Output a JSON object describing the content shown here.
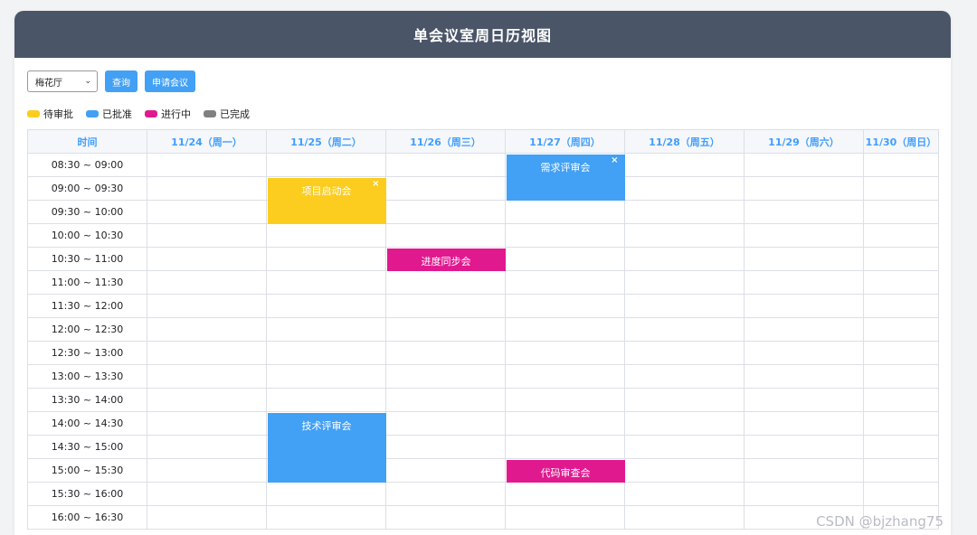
{
  "header": {
    "title": "单会议室周日历视图"
  },
  "toolbar": {
    "room_select": "梅花厅",
    "query_label": "查询",
    "apply_label": "申请会议"
  },
  "legend": [
    {
      "label": "待审批",
      "color": "#fccd1e"
    },
    {
      "label": "已批准",
      "color": "#42a0f5"
    },
    {
      "label": "进行中",
      "color": "#e0198f"
    },
    {
      "label": "已完成",
      "color": "#808080"
    }
  ],
  "table": {
    "time_header": "时间",
    "days": [
      "11/24（周一）",
      "11/25（周二）",
      "11/26（周三）",
      "11/27（周四）",
      "11/28（周五）",
      "11/29（周六）",
      "11/30（周日）"
    ],
    "slots": [
      "08:30 ~ 09:00",
      "09:00 ~ 09:30",
      "09:30 ~ 10:00",
      "10:00 ~ 10:30",
      "10:30 ~ 11:00",
      "11:00 ~ 11:30",
      "11:30 ~ 12:00",
      "12:00 ~ 12:30",
      "12:30 ~ 13:00",
      "13:00 ~ 13:30",
      "13:30 ~ 14:00",
      "14:00 ~ 14:30",
      "14:30 ~ 15:00",
      "15:00 ~ 15:30",
      "15:30 ~ 16:00",
      "16:00 ~ 16:30"
    ]
  },
  "events": [
    {
      "title": "项目启动会",
      "day": 1,
      "start": 1,
      "span": 2,
      "status": "pending",
      "color": "#fccd1e",
      "close": "×"
    },
    {
      "title": "需求评审会",
      "day": 3,
      "start": 0,
      "span": 2,
      "status": "approved",
      "color": "#42a0f5",
      "close": "×"
    },
    {
      "title": "进度同步会",
      "day": 2,
      "start": 4,
      "span": 1,
      "status": "in-progress",
      "color": "#e0198f",
      "close": ""
    },
    {
      "title": "技术评审会",
      "day": 1,
      "start": 11,
      "span": 3,
      "status": "approved",
      "color": "#42a0f5",
      "close": ""
    },
    {
      "title": "代码审查会",
      "day": 3,
      "start": 13,
      "span": 1,
      "status": "in-progress",
      "color": "#e0198f",
      "close": ""
    }
  ],
  "watermark": "CSDN @bjzhang75"
}
